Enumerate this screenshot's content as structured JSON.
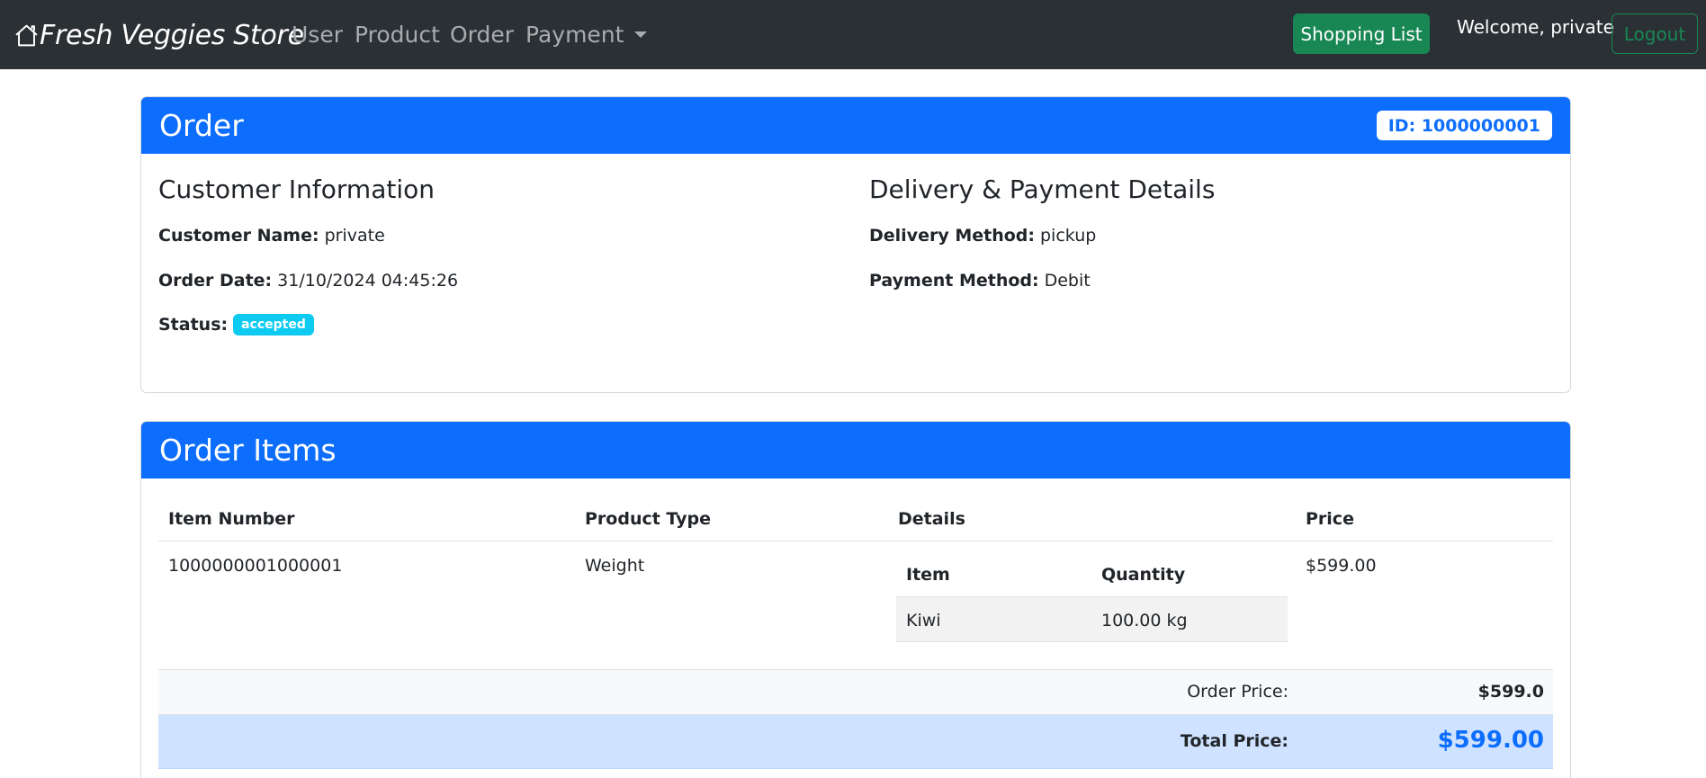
{
  "navbar": {
    "brand": "Fresh Veggies Store",
    "links": {
      "user": "User",
      "product": "Product",
      "order": "Order",
      "payment": "Payment"
    },
    "shopping_list": "Shopping List",
    "welcome": "Welcome, private",
    "logout": "Logout",
    "colors": {
      "background": "#2b3035",
      "success": "#198754"
    }
  },
  "order": {
    "title": "Order",
    "id_badge": "ID: 1000000001",
    "customer_section_title": "Customer Information",
    "customer_name_label": "Customer Name:",
    "customer_name": "private",
    "order_date_label": "Order Date:",
    "order_date": "31/10/2024 04:45:26",
    "status_label": "Status:",
    "status": "accepted",
    "delivery_section_title": "Delivery & Payment Details",
    "delivery_method_label": "Delivery Method:",
    "delivery_method": "pickup",
    "payment_method_label": "Payment Method:",
    "payment_method": "Debit",
    "colors": {
      "primary": "#0d6efd",
      "status": "#0dcaf0"
    }
  },
  "items": {
    "title": "Order Items",
    "columns": [
      "Item Number",
      "Product Type",
      "Details",
      "Price"
    ],
    "rows": [
      {
        "item_number": "1000000001000001",
        "product_type": "Weight",
        "details": {
          "columns": [
            "Item",
            "Quantity"
          ],
          "rows": [
            {
              "item": "Kiwi",
              "quantity": "100.00 kg"
            }
          ]
        },
        "price": "$599.00"
      }
    ],
    "order_price_label": "Order Price:",
    "order_price": "$599.0",
    "total_price_label": "Total Price:",
    "total_price": "$599.00"
  }
}
